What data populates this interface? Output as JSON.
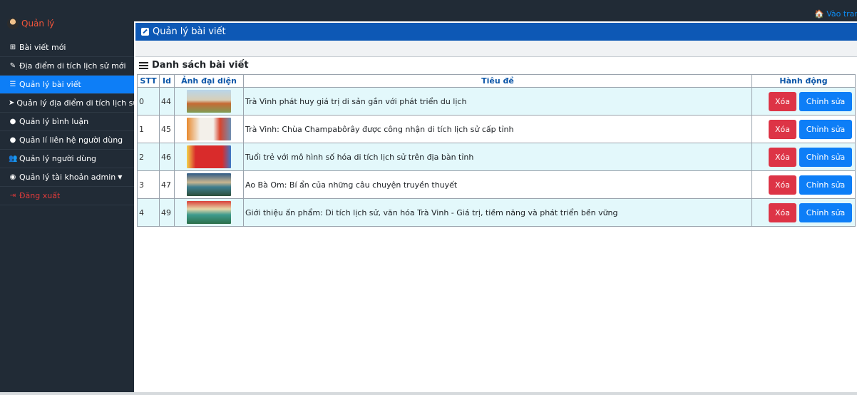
{
  "topbar": {
    "home_link": "Vào trang web"
  },
  "sidebar": {
    "brand": "Quản lý",
    "items": [
      {
        "label": "Bài viết mới",
        "icon": "plus-square-icon"
      },
      {
        "label": "Địa điểm di tích lịch sử mới",
        "icon": "edit-icon"
      },
      {
        "label": "Quản lý bài viết",
        "icon": "list-icon"
      },
      {
        "label": "Quản lý địa điểm di tích lịch sử",
        "icon": "location-arrow-icon"
      },
      {
        "label": "Quản lý bình luận",
        "icon": "comment-icon"
      },
      {
        "label": "Quản lí liên hệ người dùng",
        "icon": "comment-icon"
      },
      {
        "label": "Quản lý người dùng",
        "icon": "users-icon"
      },
      {
        "label": "Quản lý tài khoản admin",
        "icon": "user-circle-icon"
      },
      {
        "label": "Đăng xuất",
        "icon": "sign-out-icon"
      }
    ]
  },
  "main": {
    "header": "Quản lý bài viết",
    "list_title": "Danh sách bài viết",
    "columns": [
      "STT",
      "Id",
      "Ảnh đại diện",
      "Tiêu đề",
      "Hành động"
    ],
    "rows": [
      {
        "stt": "0",
        "id": "44",
        "title": "Trà Vinh phát huy giá trị di sản gắn với phát triển du lịch"
      },
      {
        "stt": "1",
        "id": "45",
        "title": "Trà Vinh: Chùa Champabôrây được công nhận di tích lịch sử cấp tỉnh"
      },
      {
        "stt": "2",
        "id": "46",
        "title": "Tuổi trẻ với mô hình số hóa di tích lịch sử trên địa bàn tỉnh"
      },
      {
        "stt": "3",
        "id": "47",
        "title": "Ao Bà Om: Bí ẩn của những câu chuyện truyền thuyết"
      },
      {
        "stt": "4",
        "id": "49",
        "title": "Giới thiệu ấn phẩm: Di tích lịch sử, văn hóa Trà Vinh - Giá trị, tiềm năng và phát triển bền vững"
      }
    ],
    "delete_label": "Xóa",
    "edit_label": "Chỉnh sửa"
  },
  "colors": {
    "sidebar_bg": "#212b36",
    "active": "#0d7ef7",
    "header": "#0d58b5",
    "danger": "#dd3446"
  }
}
